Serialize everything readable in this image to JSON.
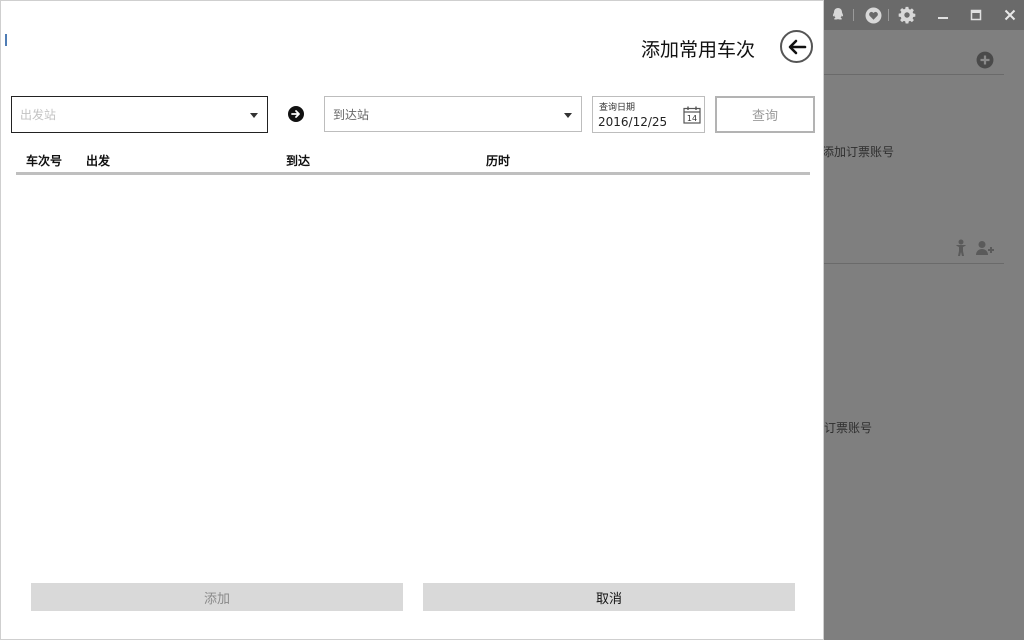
{
  "dialog": {
    "title": "添加常用车次",
    "from_placeholder": "出发站",
    "to_placeholder": "到达站",
    "date_label": "查询日期",
    "date_value": "2016/12/25",
    "calendar_day": "14",
    "query_label": "查询",
    "columns": [
      "车次号",
      "出发",
      "到达",
      "历时"
    ],
    "rows": [],
    "add_label": "添加",
    "cancel_label": "取消"
  },
  "background": {
    "text_add_account": "添加订票账号",
    "text_account_partial": "订票账号"
  },
  "icons": {
    "back": "back-arrow-icon",
    "swap": "arrow-right-icon",
    "calendar": "calendar-icon",
    "qq": "qq-icon",
    "heart": "heart-icon",
    "settings": "gear-icon",
    "minimize": "minimize-icon",
    "maximize": "maximize-icon",
    "close": "close-icon",
    "add_circle": "plus-circle-icon",
    "child": "child-icon",
    "add_user": "add-user-icon"
  }
}
